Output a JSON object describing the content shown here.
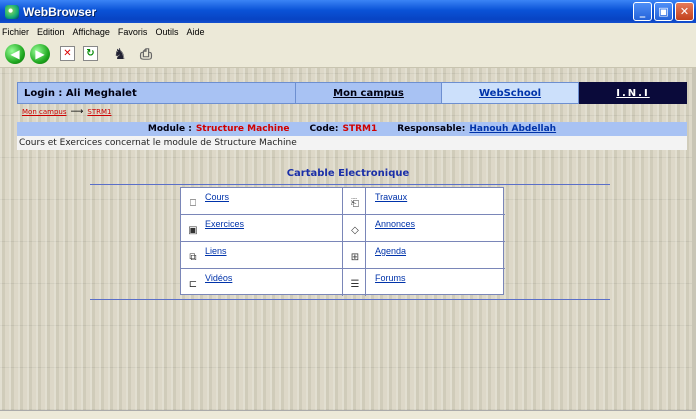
{
  "window": {
    "title": "WebBrowser"
  },
  "menu": [
    "Fichier",
    "Edition",
    "Affichage",
    "Favoris",
    "Outils",
    "Aide"
  ],
  "toolbar": {
    "icons": [
      "back-icon",
      "forward-icon",
      "stop-icon",
      "refresh-icon",
      "runner-icon",
      "printer-icon"
    ]
  },
  "header": {
    "login": "Login : Ali Meghalet",
    "campus_link": "Mon campus",
    "webschool_link": "WebSchool",
    "ini": "I.N.I"
  },
  "breadcrumb": {
    "home": "Mon campus",
    "current": "STRM1"
  },
  "module": {
    "module_label": "Module :",
    "module_value": "Structure Machine",
    "code_label": "Code:",
    "code_value": "STRM1",
    "resp_label": "Responsable:",
    "resp_value": "Hanouh Abdellah"
  },
  "description": "Cours et Exercices concernat le module de Structure Machine",
  "cartable": {
    "title": "Cartable Electronique",
    "items": [
      {
        "label": "Cours",
        "icon": "document-icon"
      },
      {
        "label": "Travaux",
        "icon": "tasks-icon"
      },
      {
        "label": "Exercices",
        "icon": "exercise-icon"
      },
      {
        "label": "Annonces",
        "icon": "announcement-icon"
      },
      {
        "label": "Liens",
        "icon": "links-icon"
      },
      {
        "label": "Agenda",
        "icon": "calendar-icon"
      },
      {
        "label": "Vidéos",
        "icon": "video-icon"
      },
      {
        "label": "Forums",
        "icon": "forum-icon"
      }
    ]
  },
  "colors": {
    "header_blue": "#a8c2f3",
    "ini_bg": "#0a0a3a",
    "accent_red": "#d00000",
    "link_blue": "#0033aa"
  }
}
